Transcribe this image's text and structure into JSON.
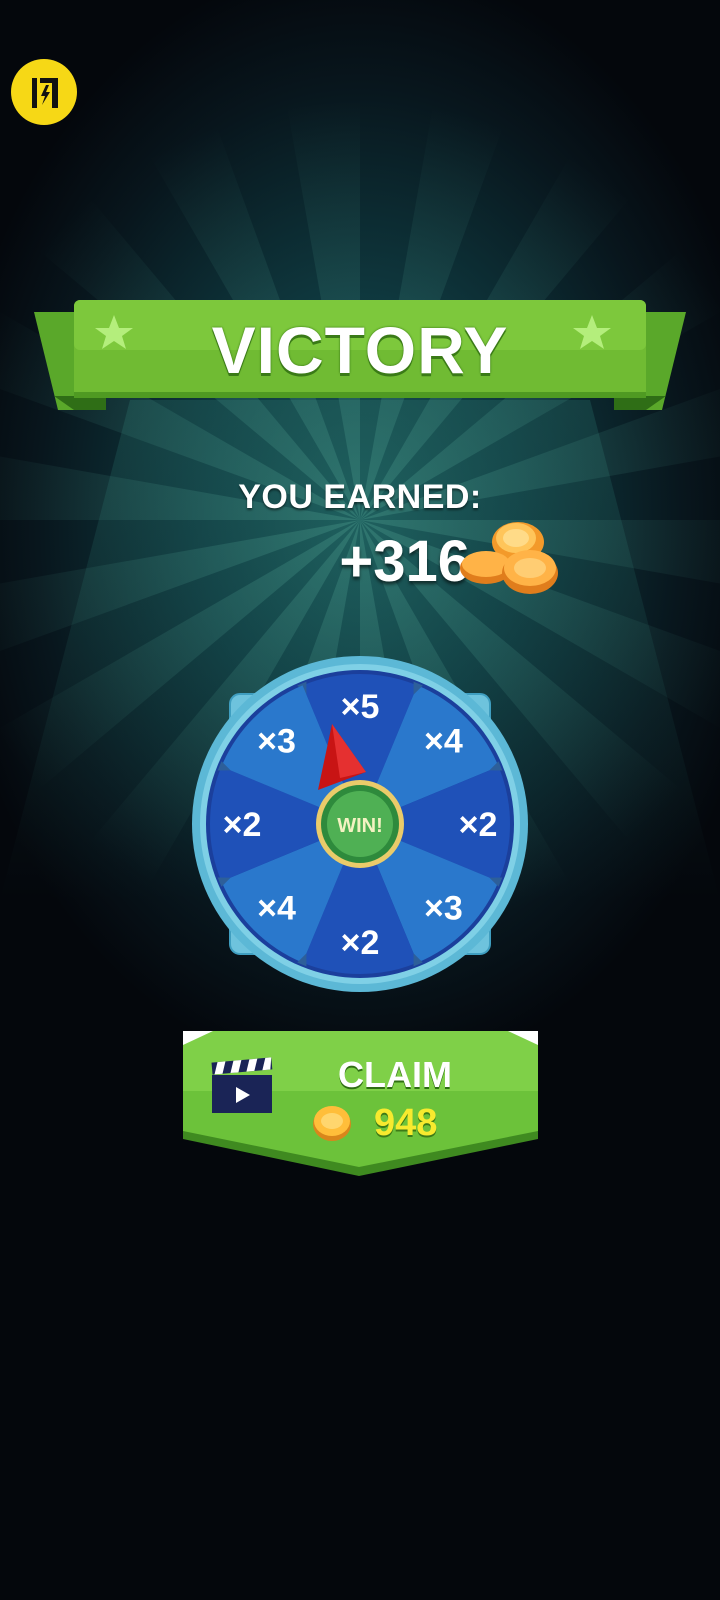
{
  "overlay": {
    "icon": "lightning-badge-icon",
    "glyph": "闪",
    "color": "#f6d816"
  },
  "banner": {
    "title": "VICTORY",
    "color": "#7cc43a",
    "star_icon": "star-icon"
  },
  "reward": {
    "label": "YOU EARNED:",
    "amount": "+316",
    "icon": "coins-icon"
  },
  "wheel": {
    "segments": [
      "×5",
      "×4",
      "×2",
      "×3",
      "×2",
      "×4",
      "×2",
      "×3"
    ],
    "center_label": "WIN!",
    "pointer_icon": "red-pointer-icon",
    "segment_colors": [
      "#1f51b8",
      "#2a78cc"
    ],
    "rim_color": "#6ec3dd"
  },
  "claim": {
    "label": "CLAIM",
    "amount": "948",
    "video_icon": "video-clapperboard-icon",
    "coin_icon": "coin-icon",
    "color": "#6cc23a"
  }
}
